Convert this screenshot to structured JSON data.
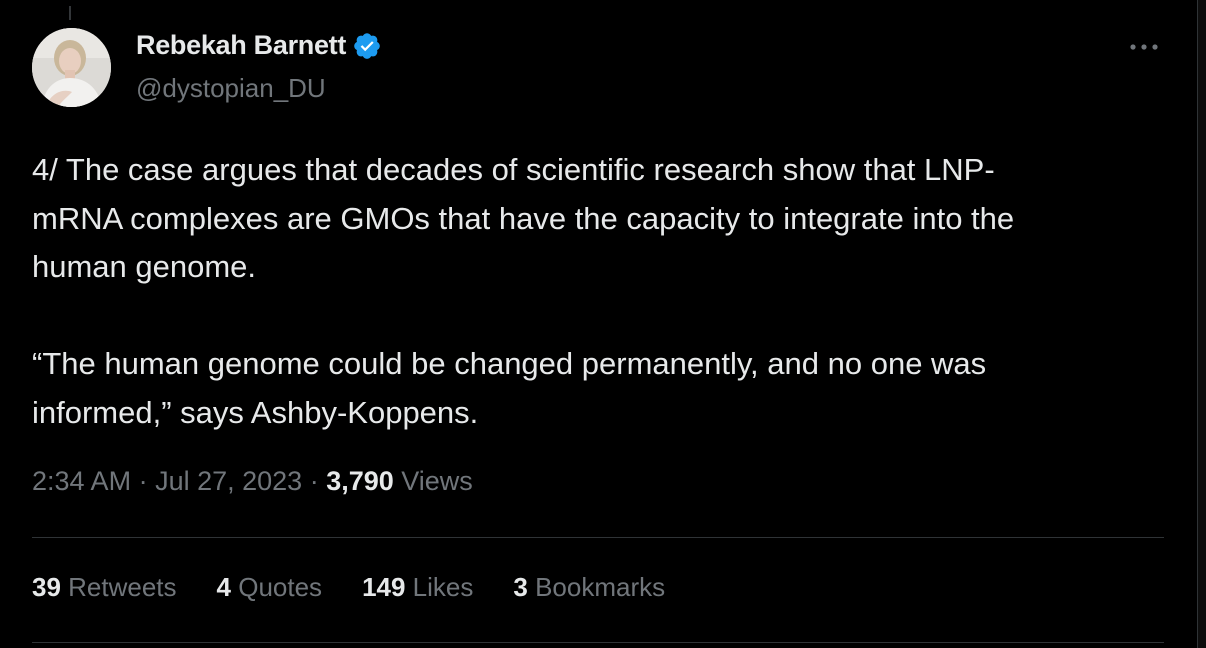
{
  "author": {
    "display_name": "Rebekah Barnett",
    "handle": "@dystopian_DU",
    "verified_color": "#1d9bf0"
  },
  "tweet": {
    "lines_para1": [
      "4/ The case argues that decades of scientific research show that LNP-",
      "mRNA complexes are GMOs that have the capacity to integrate into the",
      "human genome."
    ],
    "lines_para2": [
      "“The human genome could be changed permanently, and no one was",
      "informed,” says Ashby-Koppens."
    ]
  },
  "meta": {
    "time": "2:34 AM",
    "separator": " · ",
    "date": "Jul 27, 2023",
    "views_count": "3,790",
    "views_label": " Views"
  },
  "stats": [
    {
      "count": "39",
      "label": " Retweets"
    },
    {
      "count": "4",
      "label": " Quotes"
    },
    {
      "count": "149",
      "label": " Likes"
    },
    {
      "count": "3",
      "label": " Bookmarks"
    }
  ],
  "icons": {
    "more": "more-horizontal-icon",
    "verified": "verified-badge-icon"
  },
  "colors": {
    "background": "#000000",
    "text_primary": "#e7e9ea",
    "text_secondary": "#71767b",
    "divider": "#2f3336",
    "accent": "#1d9bf0"
  }
}
